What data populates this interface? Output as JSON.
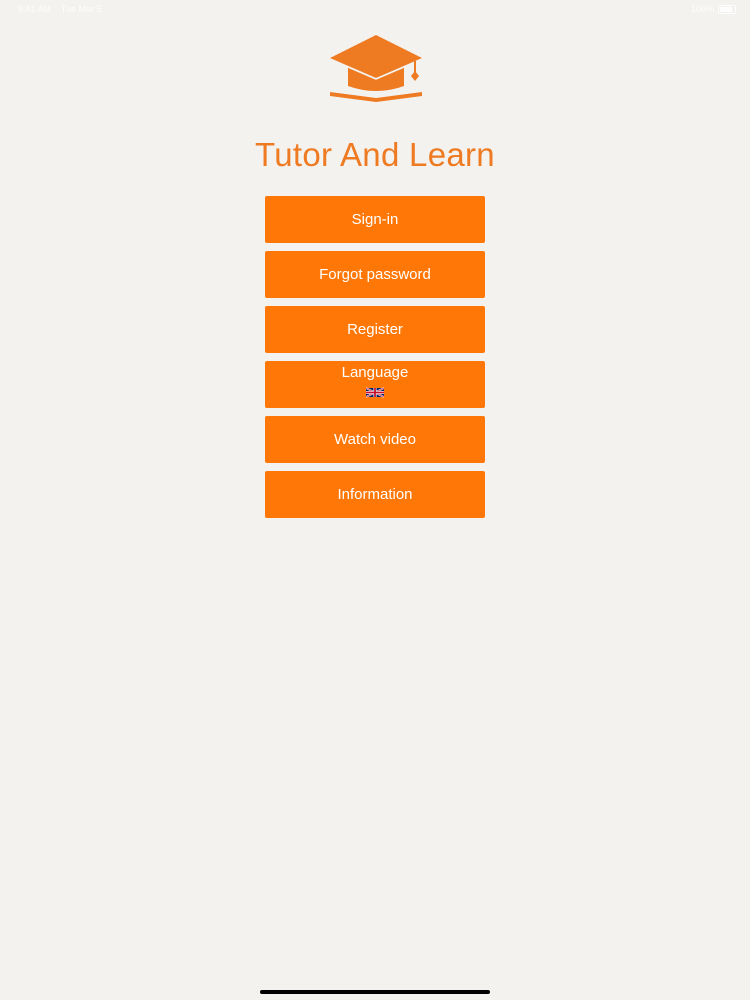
{
  "status_bar": {
    "time": "9:41 AM",
    "date": "Tue Mar 5",
    "battery": "100%"
  },
  "logo_icon": "graduation-cap-icon",
  "app_title": "Tutor And Learn",
  "menu": {
    "sign_in": "Sign-in",
    "forgot_password": "Forgot password",
    "register": "Register",
    "language": "Language",
    "language_flag": "uk-flag-icon",
    "watch_video": "Watch video",
    "information": "Information"
  },
  "colors": {
    "accent": "#ff7807",
    "title": "#ee7a22",
    "background": "#f4f2ee"
  }
}
